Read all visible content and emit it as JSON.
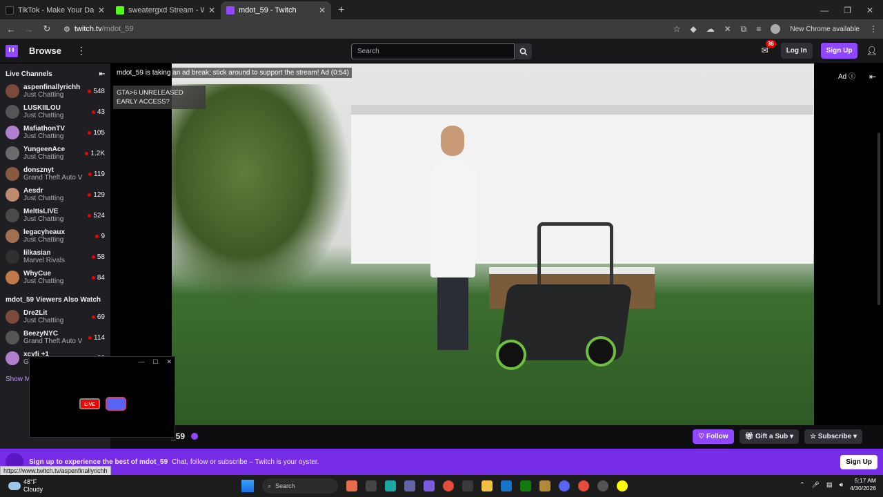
{
  "browser": {
    "tabs": [
      {
        "label": "TikTok - Make Your Day",
        "color": "#000000"
      },
      {
        "label": "sweatergxd Stream - Watch Live",
        "color": "#53fc18"
      },
      {
        "label": "mdot_59 - Twitch",
        "color": "#9146ff"
      }
    ],
    "url_host": "twitch.tv",
    "url_path": "/mdot_59",
    "chrome_available": "New Chrome available"
  },
  "twitch": {
    "browse": "Browse",
    "search_placeholder": "Search",
    "inbox_count": "36",
    "login": "Log In",
    "signup": "Sign Up"
  },
  "sidebar": {
    "header": "Live Channels",
    "channels": [
      {
        "name": "aspenfinallyrichh",
        "game": "Just Chatting",
        "viewers": "548"
      },
      {
        "name": "LUSKIILOU",
        "game": "Just Chatting",
        "viewers": "43"
      },
      {
        "name": "MafiathonTV",
        "game": "Just Chatting",
        "viewers": "105"
      },
      {
        "name": "YungeenAce",
        "game": "Just Chatting",
        "viewers": "1.2K"
      },
      {
        "name": "donsznyt",
        "game": "Grand Theft Auto V",
        "viewers": "119"
      },
      {
        "name": "Aesdr",
        "game": "Just Chatting",
        "viewers": "129"
      },
      {
        "name": "MeltIsLIVE",
        "game": "Just Chatting",
        "viewers": "524"
      },
      {
        "name": "legacyheaux",
        "game": "Just Chatting",
        "viewers": "9"
      },
      {
        "name": "lilkasian",
        "game": "Marvel Rivals",
        "viewers": "58"
      },
      {
        "name": "WhyCue",
        "game": "Just Chatting",
        "viewers": "84"
      }
    ],
    "also_watch_header": "mdot_59 Viewers Also Watch",
    "also_watch": [
      {
        "name": "Dre2Lit",
        "game": "Just Chatting",
        "viewers": "69"
      },
      {
        "name": "BeezyNYC",
        "game": "Grand Theft Auto V",
        "viewers": "114"
      },
      {
        "name": "xcyfi +1",
        "game": "Gr",
        "viewers": "23"
      }
    ],
    "show_more": "Show M"
  },
  "player": {
    "ad_text": "mdot_59 is taking an ad break; stick around to support the stream! Ad (0:54)",
    "ad_label": "Ad",
    "stream_title": "GTA>6 UNRELEASED EARLY ACCESS?"
  },
  "popup": {
    "live_label": "LIVE"
  },
  "channel_info": {
    "streamer": "_59",
    "follow": "Follow",
    "gift": "Gift a Sub",
    "subscribe": "Subscribe"
  },
  "banner": {
    "strong": "Sign up to experience the best of mdot_59",
    "text": "Chat, follow or subscribe – Twitch is your oyster.",
    "button": "Sign Up"
  },
  "status_url": "https://www.twitch.tv/aspenfinallyrichh",
  "taskbar": {
    "temp": "48°F",
    "weather": "Cloudy",
    "search": "Search",
    "time": "5:17 AM",
    "date": "4/30/2026"
  }
}
